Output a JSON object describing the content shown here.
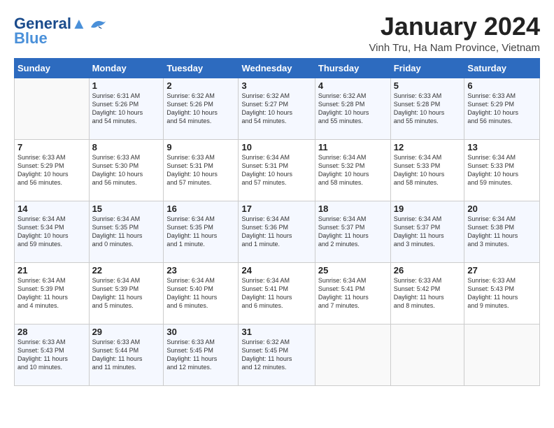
{
  "header": {
    "logo_line1": "General",
    "logo_line2": "Blue",
    "month": "January 2024",
    "location": "Vinh Tru, Ha Nam Province, Vietnam"
  },
  "weekdays": [
    "Sunday",
    "Monday",
    "Tuesday",
    "Wednesday",
    "Thursday",
    "Friday",
    "Saturday"
  ],
  "weeks": [
    [
      {
        "day": "",
        "info": ""
      },
      {
        "day": "1",
        "info": "Sunrise: 6:31 AM\nSunset: 5:26 PM\nDaylight: 10 hours\nand 54 minutes."
      },
      {
        "day": "2",
        "info": "Sunrise: 6:32 AM\nSunset: 5:26 PM\nDaylight: 10 hours\nand 54 minutes."
      },
      {
        "day": "3",
        "info": "Sunrise: 6:32 AM\nSunset: 5:27 PM\nDaylight: 10 hours\nand 54 minutes."
      },
      {
        "day": "4",
        "info": "Sunrise: 6:32 AM\nSunset: 5:28 PM\nDaylight: 10 hours\nand 55 minutes."
      },
      {
        "day": "5",
        "info": "Sunrise: 6:33 AM\nSunset: 5:28 PM\nDaylight: 10 hours\nand 55 minutes."
      },
      {
        "day": "6",
        "info": "Sunrise: 6:33 AM\nSunset: 5:29 PM\nDaylight: 10 hours\nand 56 minutes."
      }
    ],
    [
      {
        "day": "7",
        "info": "Sunrise: 6:33 AM\nSunset: 5:29 PM\nDaylight: 10 hours\nand 56 minutes."
      },
      {
        "day": "8",
        "info": "Sunrise: 6:33 AM\nSunset: 5:30 PM\nDaylight: 10 hours\nand 56 minutes."
      },
      {
        "day": "9",
        "info": "Sunrise: 6:33 AM\nSunset: 5:31 PM\nDaylight: 10 hours\nand 57 minutes."
      },
      {
        "day": "10",
        "info": "Sunrise: 6:34 AM\nSunset: 5:31 PM\nDaylight: 10 hours\nand 57 minutes."
      },
      {
        "day": "11",
        "info": "Sunrise: 6:34 AM\nSunset: 5:32 PM\nDaylight: 10 hours\nand 58 minutes."
      },
      {
        "day": "12",
        "info": "Sunrise: 6:34 AM\nSunset: 5:33 PM\nDaylight: 10 hours\nand 58 minutes."
      },
      {
        "day": "13",
        "info": "Sunrise: 6:34 AM\nSunset: 5:33 PM\nDaylight: 10 hours\nand 59 minutes."
      }
    ],
    [
      {
        "day": "14",
        "info": "Sunrise: 6:34 AM\nSunset: 5:34 PM\nDaylight: 10 hours\nand 59 minutes."
      },
      {
        "day": "15",
        "info": "Sunrise: 6:34 AM\nSunset: 5:35 PM\nDaylight: 11 hours\nand 0 minutes."
      },
      {
        "day": "16",
        "info": "Sunrise: 6:34 AM\nSunset: 5:35 PM\nDaylight: 11 hours\nand 1 minute."
      },
      {
        "day": "17",
        "info": "Sunrise: 6:34 AM\nSunset: 5:36 PM\nDaylight: 11 hours\nand 1 minute."
      },
      {
        "day": "18",
        "info": "Sunrise: 6:34 AM\nSunset: 5:37 PM\nDaylight: 11 hours\nand 2 minutes."
      },
      {
        "day": "19",
        "info": "Sunrise: 6:34 AM\nSunset: 5:37 PM\nDaylight: 11 hours\nand 3 minutes."
      },
      {
        "day": "20",
        "info": "Sunrise: 6:34 AM\nSunset: 5:38 PM\nDaylight: 11 hours\nand 3 minutes."
      }
    ],
    [
      {
        "day": "21",
        "info": "Sunrise: 6:34 AM\nSunset: 5:39 PM\nDaylight: 11 hours\nand 4 minutes."
      },
      {
        "day": "22",
        "info": "Sunrise: 6:34 AM\nSunset: 5:39 PM\nDaylight: 11 hours\nand 5 minutes."
      },
      {
        "day": "23",
        "info": "Sunrise: 6:34 AM\nSunset: 5:40 PM\nDaylight: 11 hours\nand 6 minutes."
      },
      {
        "day": "24",
        "info": "Sunrise: 6:34 AM\nSunset: 5:41 PM\nDaylight: 11 hours\nand 6 minutes."
      },
      {
        "day": "25",
        "info": "Sunrise: 6:34 AM\nSunset: 5:41 PM\nDaylight: 11 hours\nand 7 minutes."
      },
      {
        "day": "26",
        "info": "Sunrise: 6:33 AM\nSunset: 5:42 PM\nDaylight: 11 hours\nand 8 minutes."
      },
      {
        "day": "27",
        "info": "Sunrise: 6:33 AM\nSunset: 5:43 PM\nDaylight: 11 hours\nand 9 minutes."
      }
    ],
    [
      {
        "day": "28",
        "info": "Sunrise: 6:33 AM\nSunset: 5:43 PM\nDaylight: 11 hours\nand 10 minutes."
      },
      {
        "day": "29",
        "info": "Sunrise: 6:33 AM\nSunset: 5:44 PM\nDaylight: 11 hours\nand 11 minutes."
      },
      {
        "day": "30",
        "info": "Sunrise: 6:33 AM\nSunset: 5:45 PM\nDaylight: 11 hours\nand 12 minutes."
      },
      {
        "day": "31",
        "info": "Sunrise: 6:32 AM\nSunset: 5:45 PM\nDaylight: 11 hours\nand 12 minutes."
      },
      {
        "day": "",
        "info": ""
      },
      {
        "day": "",
        "info": ""
      },
      {
        "day": "",
        "info": ""
      }
    ]
  ]
}
